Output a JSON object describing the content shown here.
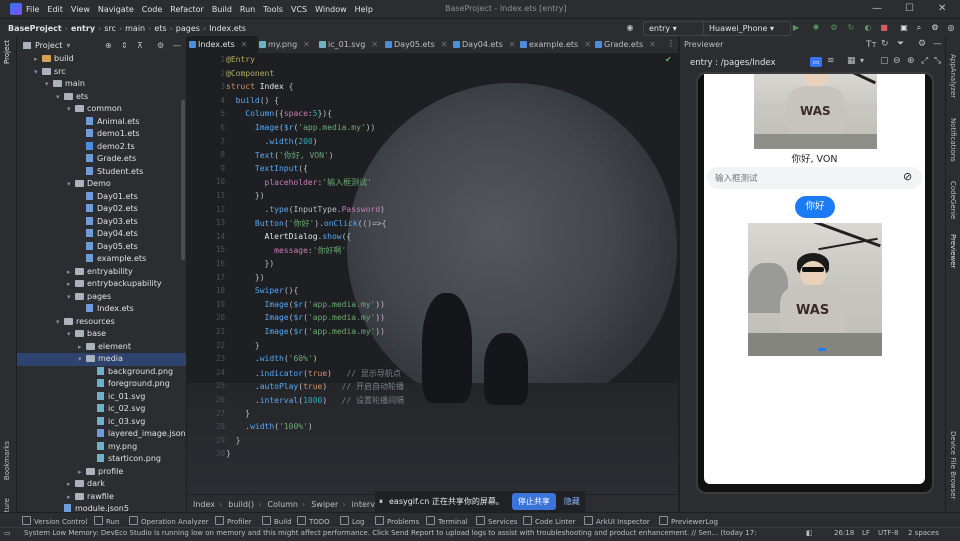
{
  "menubar": {
    "items": [
      "File",
      "Edit",
      "View",
      "Navigate",
      "Code",
      "Refactor",
      "Build",
      "Run",
      "Tools",
      "VCS",
      "Window",
      "Help"
    ],
    "title": "BaseProject - Index.ets [entry]"
  },
  "navbar": {
    "breadcrumb": [
      "BaseProject",
      "entry",
      "src",
      "main",
      "ets",
      "pages",
      "Index.ets"
    ],
    "module_combo": "entry",
    "device_combo": "Huawei_Phone"
  },
  "project_panel": {
    "title": "Project",
    "tree": [
      {
        "label": "build",
        "depth": 1,
        "kind": "folder-orange",
        "open": false
      },
      {
        "label": "src",
        "depth": 1,
        "kind": "folder",
        "open": true
      },
      {
        "label": "main",
        "depth": 2,
        "kind": "folder",
        "open": true
      },
      {
        "label": "ets",
        "depth": 3,
        "kind": "folder",
        "open": true
      },
      {
        "label": "common",
        "depth": 4,
        "kind": "folder",
        "open": true
      },
      {
        "label": "Animal.ets",
        "depth": 5,
        "kind": "file"
      },
      {
        "label": "demo1.ets",
        "depth": 5,
        "kind": "file"
      },
      {
        "label": "demo2.ts",
        "depth": 5,
        "kind": "file-ts"
      },
      {
        "label": "Grade.ets",
        "depth": 5,
        "kind": "file"
      },
      {
        "label": "Student.ets",
        "depth": 5,
        "kind": "file"
      },
      {
        "label": "Demo",
        "depth": 4,
        "kind": "folder",
        "open": true
      },
      {
        "label": "Day01.ets",
        "depth": 5,
        "kind": "file"
      },
      {
        "label": "Day02.ets",
        "depth": 5,
        "kind": "file"
      },
      {
        "label": "Day03.ets",
        "depth": 5,
        "kind": "file"
      },
      {
        "label": "Day04.ets",
        "depth": 5,
        "kind": "file"
      },
      {
        "label": "Day05.ets",
        "depth": 5,
        "kind": "file"
      },
      {
        "label": "example.ets",
        "depth": 5,
        "kind": "file"
      },
      {
        "label": "entryability",
        "depth": 4,
        "kind": "folder",
        "open": false
      },
      {
        "label": "entrybackupability",
        "depth": 4,
        "kind": "folder",
        "open": false
      },
      {
        "label": "pages",
        "depth": 4,
        "kind": "folder",
        "open": true
      },
      {
        "label": "Index.ets",
        "depth": 5,
        "kind": "file"
      },
      {
        "label": "resources",
        "depth": 3,
        "kind": "folder",
        "open": true
      },
      {
        "label": "base",
        "depth": 4,
        "kind": "folder",
        "open": true
      },
      {
        "label": "element",
        "depth": 5,
        "kind": "folder",
        "open": false
      },
      {
        "label": "media",
        "depth": 5,
        "kind": "folder",
        "open": true,
        "selected": true
      },
      {
        "label": "background.png",
        "depth": 6,
        "kind": "file-img"
      },
      {
        "label": "foreground.png",
        "depth": 6,
        "kind": "file-img"
      },
      {
        "label": "ic_01.svg",
        "depth": 6,
        "kind": "file-img"
      },
      {
        "label": "ic_02.svg",
        "depth": 6,
        "kind": "file-img"
      },
      {
        "label": "ic_03.svg",
        "depth": 6,
        "kind": "file-img"
      },
      {
        "label": "layered_image.json",
        "depth": 6,
        "kind": "file"
      },
      {
        "label": "my.png",
        "depth": 6,
        "kind": "file-img"
      },
      {
        "label": "starticon.png",
        "depth": 6,
        "kind": "file-img"
      },
      {
        "label": "profile",
        "depth": 5,
        "kind": "folder",
        "open": false
      },
      {
        "label": "dark",
        "depth": 4,
        "kind": "folder",
        "open": false
      },
      {
        "label": "rawfile",
        "depth": 4,
        "kind": "folder",
        "open": false
      },
      {
        "label": "module.json5",
        "depth": 3,
        "kind": "file"
      }
    ]
  },
  "tabs": [
    {
      "label": "Index.ets",
      "active": true
    },
    {
      "label": "my.png"
    },
    {
      "label": "ic_01.svg"
    },
    {
      "label": "Day05.ets"
    },
    {
      "label": "Day04.ets"
    },
    {
      "label": "example.ets"
    },
    {
      "label": "Grade.ets"
    }
  ],
  "code_lines": [
    {
      "n": "1",
      "html": "<span class='dec'>@Entry</span>"
    },
    {
      "n": "2",
      "html": "<span class='dec'>@Component</span>"
    },
    {
      "n": "3",
      "html": "<span class='kw'>struct</span> <span class='cls'>Index</span> {"
    },
    {
      "n": "4",
      "html": "  <span class='fn'>build</span>() {"
    },
    {
      "n": "5",
      "html": "    <span class='fn'>Column</span>({<span class='prop'>space</span>:<span class='num'>5</span>}){"
    },
    {
      "n": "6",
      "html": "      <span class='fn'>Image</span>(<span class='fn'>$r</span>(<span class='str'>'app.media.my'</span>))"
    },
    {
      "n": "7",
      "html": "        .<span class='fn'>width</span>(<span class='num'>200</span>)"
    },
    {
      "n": "8",
      "html": "      <span class='fn'>Text</span>(<span class='str'>'你好, VON'</span>)"
    },
    {
      "n": "9",
      "html": "      <span class='fn'>TextInput</span>({"
    },
    {
      "n": "10",
      "html": "        <span class='prop'>placeholder</span>:<span class='str'>'输入框测试'</span>"
    },
    {
      "n": "11",
      "html": "      })"
    },
    {
      "n": "12",
      "html": "        .<span class='fn'>type</span>(InputType.<span class='prop'>Password</span>)"
    },
    {
      "n": "13",
      "html": "      <span class='fn'>Button</span>(<span class='str'>'你好'</span>).<span class='fn'>onClick</span>(()=>{"
    },
    {
      "n": "14",
      "html": "        <span class='cls'>AlertDialog</span>.<span class='fn'>show</span>({"
    },
    {
      "n": "15",
      "html": "          <span class='prop'>message</span>:<span class='str'>'你好啊'</span>"
    },
    {
      "n": "16",
      "html": "        })"
    },
    {
      "n": "17",
      "html": "      })"
    },
    {
      "n": "18",
      "html": "      <span class='fn'>Swiper</span>(){"
    },
    {
      "n": "19",
      "html": "        <span class='fn'>Image</span>(<span class='fn'>$r</span>(<span class='str'>'app.media.my'</span>))"
    },
    {
      "n": "20",
      "html": "        <span class='fn'>Image</span>(<span class='fn'>$r</span>(<span class='str'>'app.media.my'</span>))"
    },
    {
      "n": "21",
      "html": "        <span class='fn'>Image</span>(<span class='fn'>$r</span>(<span class='str'>'app.media.my'</span>))"
    },
    {
      "n": "22",
      "html": "      }"
    },
    {
      "n": "23",
      "html": "      .<span class='fn'>width</span>(<span class='str'>'60%'</span>)"
    },
    {
      "n": "24",
      "html": "      .<span class='fn'>indicator</span>(<span class='kw'>true</span>)   <span class='cm'>// 显示导航点</span>"
    },
    {
      "n": "25",
      "html": "      .<span class='fn'>autoPlay</span>(<span class='kw'>true</span>)   <span class='cm'>// 开启自动轮播</span>"
    },
    {
      "n": "26",
      "html": "      .<span class='fn'>interval</span>(<span class='num'>1000</span>)   <span class='cm'>// 设置轮播间隔</span>"
    },
    {
      "n": "27",
      "html": "    }"
    },
    {
      "n": "28",
      "html": "    .<span class='fn'>width</span>(<span class='str'>'100%'</span>)"
    },
    {
      "n": "29",
      "html": "  }"
    },
    {
      "n": "30",
      "html": "}"
    }
  ],
  "editor_breadcrumb": [
    "Index",
    "build()",
    "Column",
    "Swiper",
    "interval"
  ],
  "previewer": {
    "title": "Previewer",
    "route": "entry : /pages/Index",
    "greeting": "你好, VON",
    "input_placeholder": "输入框测试",
    "button_label": "你好",
    "photo_caption": "WAS"
  },
  "right_strip": [
    "AppAnalyzer",
    "Notifications",
    "CodeGenie",
    "Previewer",
    "Device File Browser"
  ],
  "left_strip": [
    "Project",
    "Bookmarks",
    "Structure"
  ],
  "tool_windows": [
    "Version Control",
    "Run",
    "Operation Analyzer",
    "Profiler",
    "Build",
    "TODO",
    "Log",
    "Problems",
    "Terminal",
    "Services",
    "Code Linter",
    "ArkUI Inspector",
    "PreviewerLog"
  ],
  "share": {
    "text": "easygif.cn 正在共享你的屏幕。",
    "stop_label": "停止共享",
    "hide_label": "隐藏"
  },
  "status": {
    "message": "System Low Memory: DevEco Studio is running low on memory and this might affect performance. Click Send Report to upload logs to assist with troubleshooting and product enhancement. // Sen... (today 17:",
    "position": "26:18",
    "line_sep": "LF",
    "encoding": "UTF-8",
    "indent": "2 spaces"
  },
  "colors": {
    "accent": "#3574f0",
    "button": "#1a7bf5",
    "bg_panel": "#2b2d30",
    "bg_editor": "#1e1f22"
  }
}
